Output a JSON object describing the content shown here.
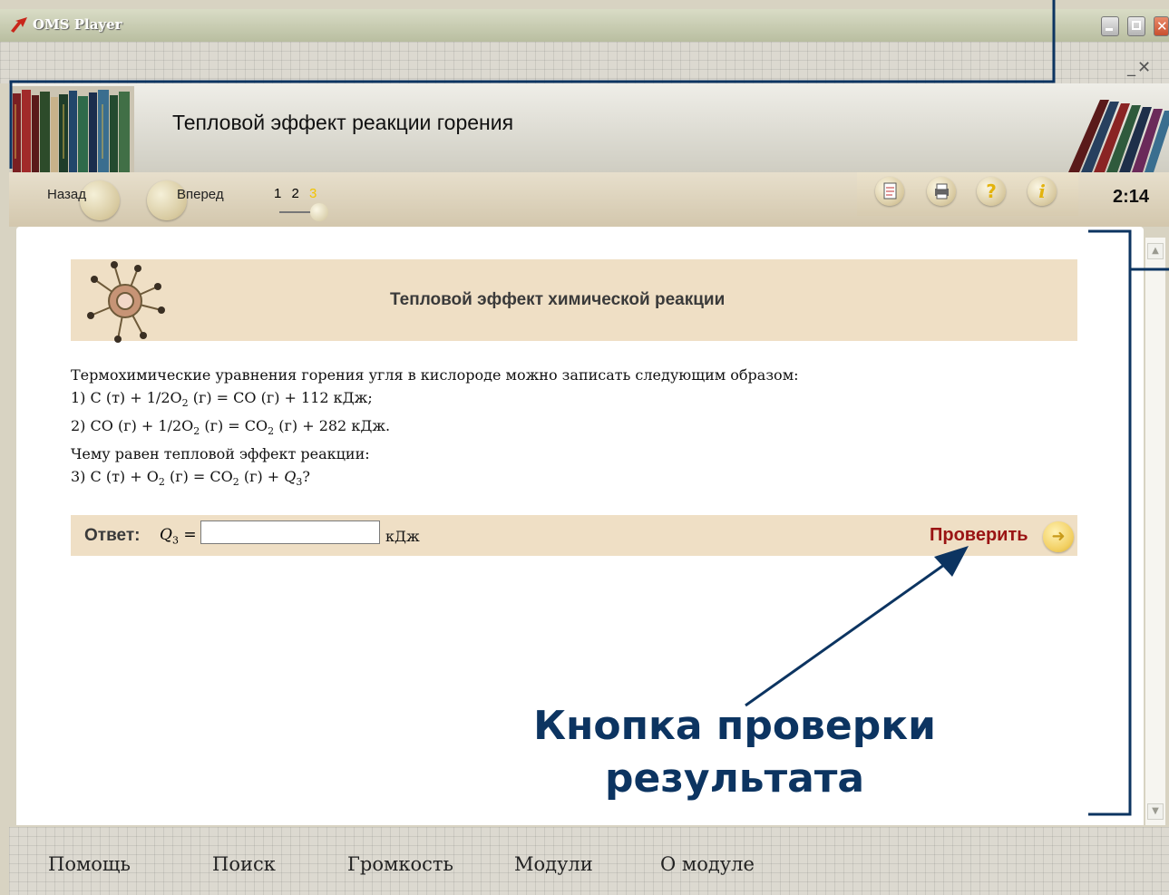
{
  "window": {
    "title": "OMS Player"
  },
  "header": {
    "title": "Тепловой эффект реакции горения"
  },
  "nav": {
    "back_label": "Назад",
    "forward_label": "Вперед",
    "pages": [
      "1",
      "2",
      "3"
    ],
    "current_page": "3"
  },
  "toolbar": {
    "icons": [
      "notebook-icon",
      "print-icon",
      "help-icon",
      "info-icon"
    ],
    "help_glyph": "?",
    "info_glyph": "i",
    "timer": "2:14"
  },
  "task": {
    "title": "Тепловой эффект химической реакции",
    "intro": "Термохимические уравнения горения угля в кислороде можно записать следующим образом:",
    "eq1": {
      "prefix": "1) C (т) + 1/2O",
      "sub1": "2",
      "suffix": " (г) = CO (г) + 112 кДж;"
    },
    "eq2": {
      "prefix": "2) CO (г) + 1/2O",
      "sub1": "2",
      "mid": " (г) = CO",
      "sub2": "2",
      "suffix": " (г) + 282 кДж."
    },
    "question": "Чему равен тепловой эффект реакции:",
    "eq3": {
      "prefix": "3) C (т) + O",
      "sub1": "2",
      "mid": " (г) = CO",
      "sub2": "2",
      "mid2": " (г) + ",
      "q": "Q",
      "qsub": "3",
      "suffix": "?"
    }
  },
  "answer": {
    "label": "Ответ:",
    "var": "Q",
    "var_sub": "3",
    "equals": "=",
    "value": "",
    "unit": "кДж",
    "check_label": "Проверить"
  },
  "callout": {
    "line1": "Кнопка проверки",
    "line2": "результата"
  },
  "bottom_menu": [
    "Помощь",
    "Поиск",
    "Громкость",
    "Модули",
    "О модуле"
  ],
  "colors": {
    "callout": "#0c3461",
    "check_label": "#9a1414",
    "panel": "#efdfc5"
  }
}
